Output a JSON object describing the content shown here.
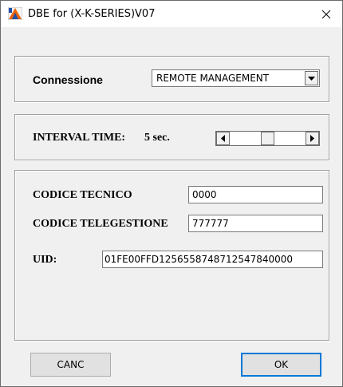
{
  "window": {
    "title": "DBE for (X-K-SERIES)V07",
    "icon": "app-logo-icon",
    "close_glyph": "✕"
  },
  "connection": {
    "label": "Connessione",
    "selected": "REMOTE MANAGEMENT"
  },
  "interval": {
    "label": "INTERVAL TIME:",
    "value": "5 sec.",
    "slider_fraction": 0.5
  },
  "codes": {
    "tech_label": "CODICE TECNICO",
    "tech_value": "0000",
    "telemgmt_label": "CODICE TELEGESTIONE",
    "telemgmt_value": "777777",
    "uid_label": "UID:",
    "uid_value": "01FE00FFD1256558748712547840000"
  },
  "buttons": {
    "cancel": "CANC",
    "ok": "OK"
  },
  "colors": {
    "accent": "#0078d7",
    "dialog_bg": "#f0f0f0",
    "icon_orange": "#e8630a"
  }
}
